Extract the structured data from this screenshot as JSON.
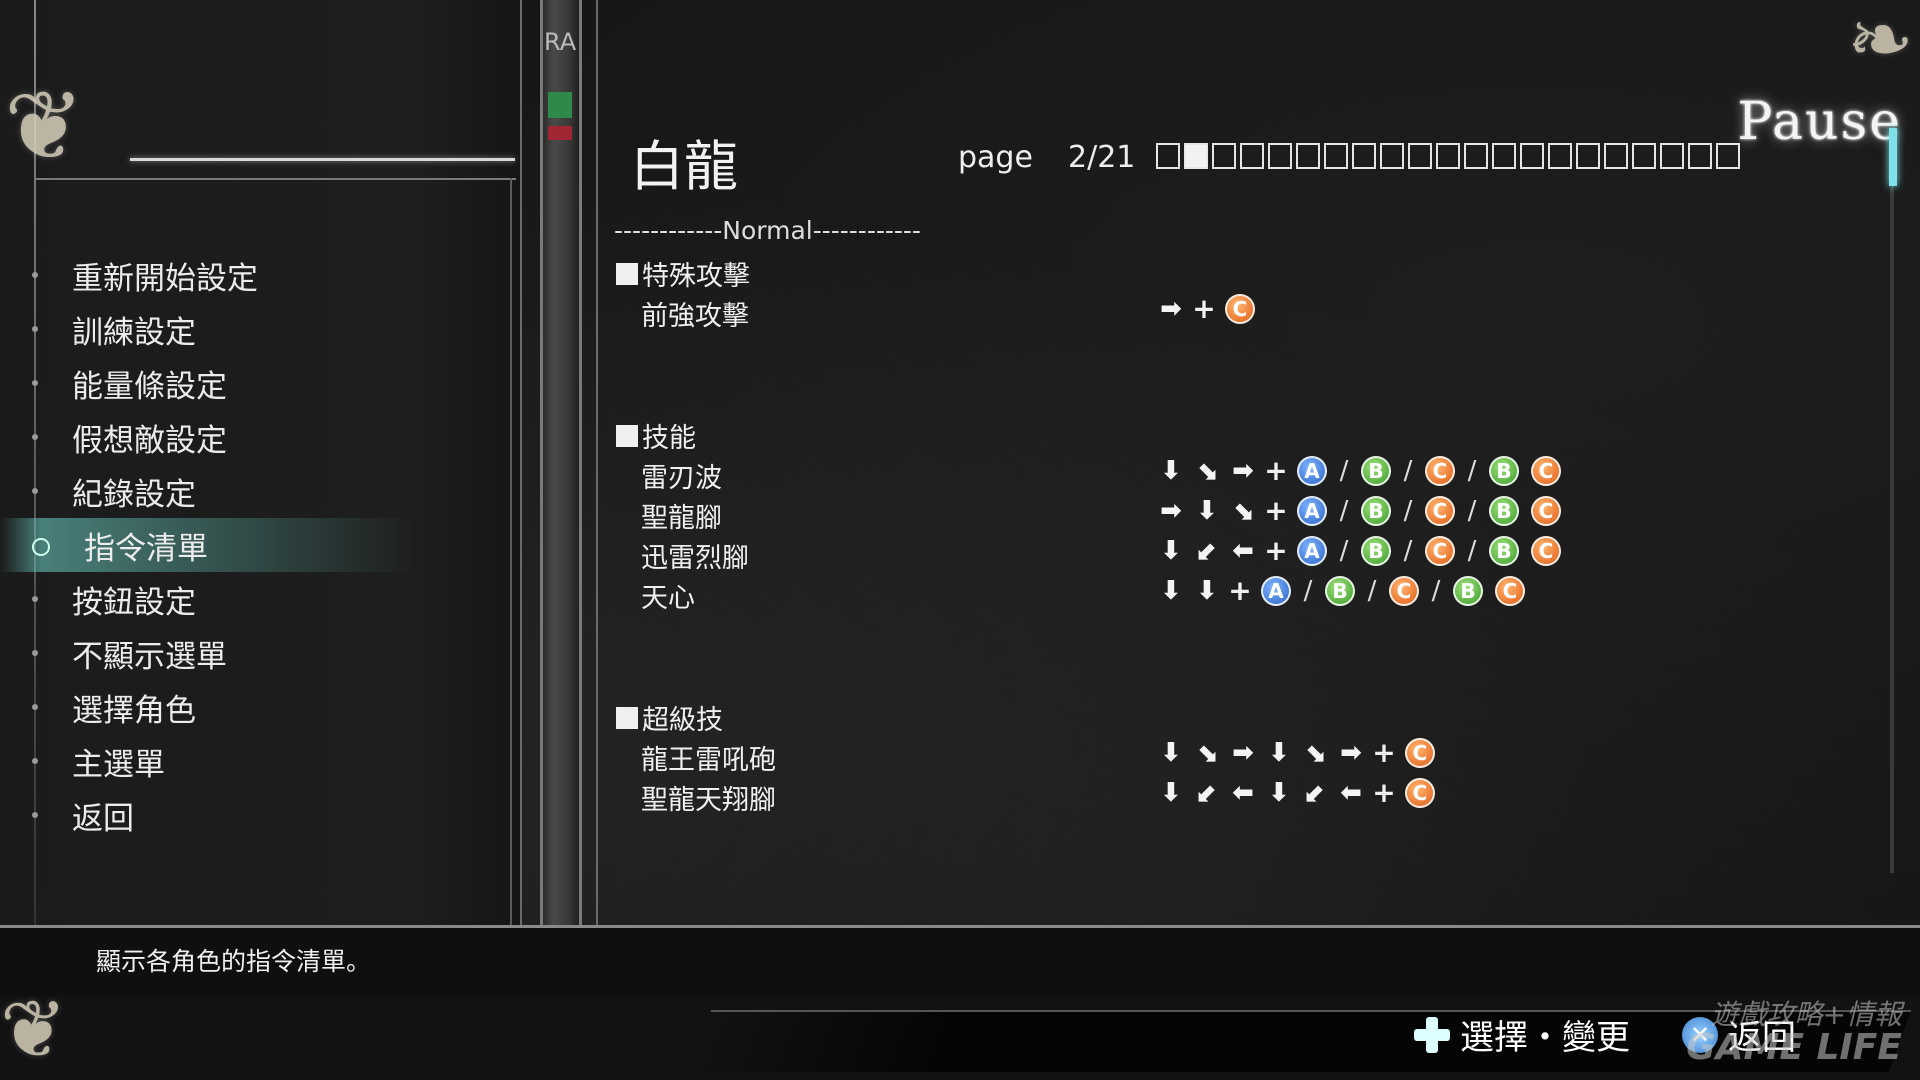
{
  "pause_menu": {
    "title": "Pause",
    "items": [
      {
        "label": "重新開始設定",
        "selected": false
      },
      {
        "label": "訓練設定",
        "selected": false
      },
      {
        "label": "能量條設定",
        "selected": false
      },
      {
        "label": "假想敵設定",
        "selected": false
      },
      {
        "label": "紀錄設定",
        "selected": false
      },
      {
        "label": "指令清單",
        "selected": true
      },
      {
        "label": "按鈕設定",
        "selected": false
      },
      {
        "label": "不顯示選單",
        "selected": false
      },
      {
        "label": "選擇角色",
        "selected": false
      },
      {
        "label": "主選單",
        "selected": false
      },
      {
        "label": "返回",
        "selected": false
      }
    ]
  },
  "side_strip": {
    "text": "RA"
  },
  "command_list": {
    "character": "白龍",
    "page_label": "page",
    "page_number": "2/21",
    "page_current": 2,
    "page_total": 21,
    "divider": "------------Normal------------",
    "sections": [
      {
        "title": "特殊攻擊",
        "commands": [
          {
            "name": "前強攻擊",
            "sequence": [
              "right-arrow",
              "plus",
              "btn-c"
            ]
          }
        ]
      },
      {
        "title": "技能",
        "commands": [
          {
            "name": "雷刃波",
            "sequence": [
              "down-arrow",
              "down-right-arrow",
              "right-arrow",
              "plus",
              "btn-a",
              "slash",
              "btn-b",
              "slash",
              "btn-c",
              "slash",
              "btn-b",
              "btn-c"
            ]
          },
          {
            "name": "聖龍腳",
            "sequence": [
              "right-arrow",
              "down-arrow",
              "down-right-arrow",
              "plus",
              "btn-a",
              "slash",
              "btn-b",
              "slash",
              "btn-c",
              "slash",
              "btn-b",
              "btn-c"
            ]
          },
          {
            "name": "迅雷烈腳",
            "sequence": [
              "down-arrow",
              "down-left-arrow",
              "left-arrow",
              "plus",
              "btn-a",
              "slash",
              "btn-b",
              "slash",
              "btn-c",
              "slash",
              "btn-b",
              "btn-c"
            ]
          },
          {
            "name": "天心",
            "sequence": [
              "down-arrow",
              "down-arrow",
              "plus",
              "btn-a",
              "slash",
              "btn-b",
              "slash",
              "btn-c",
              "slash",
              "btn-b",
              "btn-c"
            ]
          }
        ]
      },
      {
        "title": "超級技",
        "commands": [
          {
            "name": "龍王雷吼砲",
            "sequence": [
              "down-arrow",
              "down-right-arrow",
              "right-arrow",
              "down-arrow",
              "down-right-arrow",
              "right-arrow",
              "plus",
              "btn-c"
            ]
          },
          {
            "name": "聖龍天翔腳",
            "sequence": [
              "down-arrow",
              "down-left-arrow",
              "left-arrow",
              "down-arrow",
              "down-left-arrow",
              "left-arrow",
              "plus",
              "btn-c"
            ]
          }
        ]
      }
    ]
  },
  "button_glyphs": {
    "btn-a": "A",
    "btn-b": "B",
    "btn-c": "C"
  },
  "arrow_glyphs": {
    "right-arrow": "➡",
    "left-arrow": "⬅",
    "down-arrow": "⬇",
    "down-right-arrow": "⬊",
    "down-left-arrow": "⬋",
    "plus": "+",
    "slash": "/"
  },
  "description": "顯示各角色的指令清單。",
  "hints": {
    "select_change": "選擇・變更",
    "back": "返回",
    "dpad_icon": "dpad-icon",
    "cross_icon": "cross-button-icon"
  },
  "watermark": {
    "line1": "遊戲攻略+情報",
    "line2": "GAME LIFE"
  },
  "colors": {
    "accent_teal": "#7fe0e8",
    "btn_a": "#2b62c6",
    "btn_b": "#3d9a2c",
    "btn_c": "#e05b14"
  }
}
